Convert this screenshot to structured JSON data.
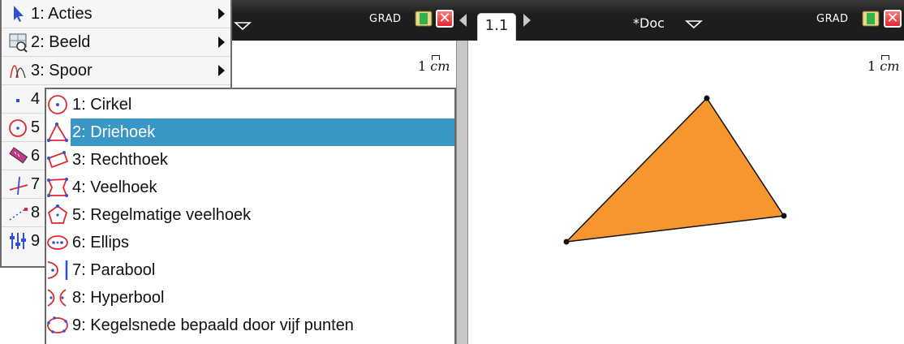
{
  "status": {
    "mode_left": "GRAD",
    "mode_right": "GRAD",
    "page_tab": "1.1",
    "document_title": "*Doc"
  },
  "scale": {
    "left": {
      "number": "1",
      "unit": "cm"
    },
    "right": {
      "number": "1",
      "unit": "cm"
    }
  },
  "main_menu": {
    "items": [
      {
        "label": "1: Acties",
        "icon": "arrow-pointer-icon",
        "has_submenu": true
      },
      {
        "label": "2: Beeld",
        "icon": "view-icon",
        "has_submenu": true
      },
      {
        "label": "3: Spoor",
        "icon": "trace-icon",
        "has_submenu": true
      },
      {
        "label": "4",
        "icon": "point-icon",
        "has_submenu": false
      },
      {
        "label": "5",
        "icon": "circle-icon",
        "has_submenu": false
      },
      {
        "label": "6",
        "icon": "measure-icon",
        "has_submenu": false
      },
      {
        "label": "7",
        "icon": "construction-icon",
        "has_submenu": false
      },
      {
        "label": "8",
        "icon": "transform-icon",
        "has_submenu": false
      },
      {
        "label": "9",
        "icon": "settings-sliders-icon",
        "has_submenu": false
      }
    ]
  },
  "submenu": {
    "selected_index": 1,
    "items": [
      {
        "label": "1: Cirkel",
        "icon": "circle-icon"
      },
      {
        "label": "2: Driehoek",
        "icon": "triangle-icon"
      },
      {
        "label": "3: Rechthoek",
        "icon": "rectangle-icon"
      },
      {
        "label": "4: Veelhoek",
        "icon": "polygon-icon"
      },
      {
        "label": "5: Regelmatige veelhoek",
        "icon": "regular-polygon-icon"
      },
      {
        "label": "6: Ellips",
        "icon": "ellipse-icon"
      },
      {
        "label": "7: Parabool",
        "icon": "parabola-icon"
      },
      {
        "label": "8: Hyperbool",
        "icon": "hyperbola-icon"
      },
      {
        "label": "9: Kegelsnede bepaald door vijf punten",
        "icon": "conic-five-points-icon"
      }
    ]
  },
  "colors": {
    "topbar": "#1d1d1d",
    "selection": "#3a96c4",
    "triangle_fill": "#f7962e",
    "menu_icon_red": "#e0282e",
    "menu_icon_blue": "#2f4fd8"
  }
}
